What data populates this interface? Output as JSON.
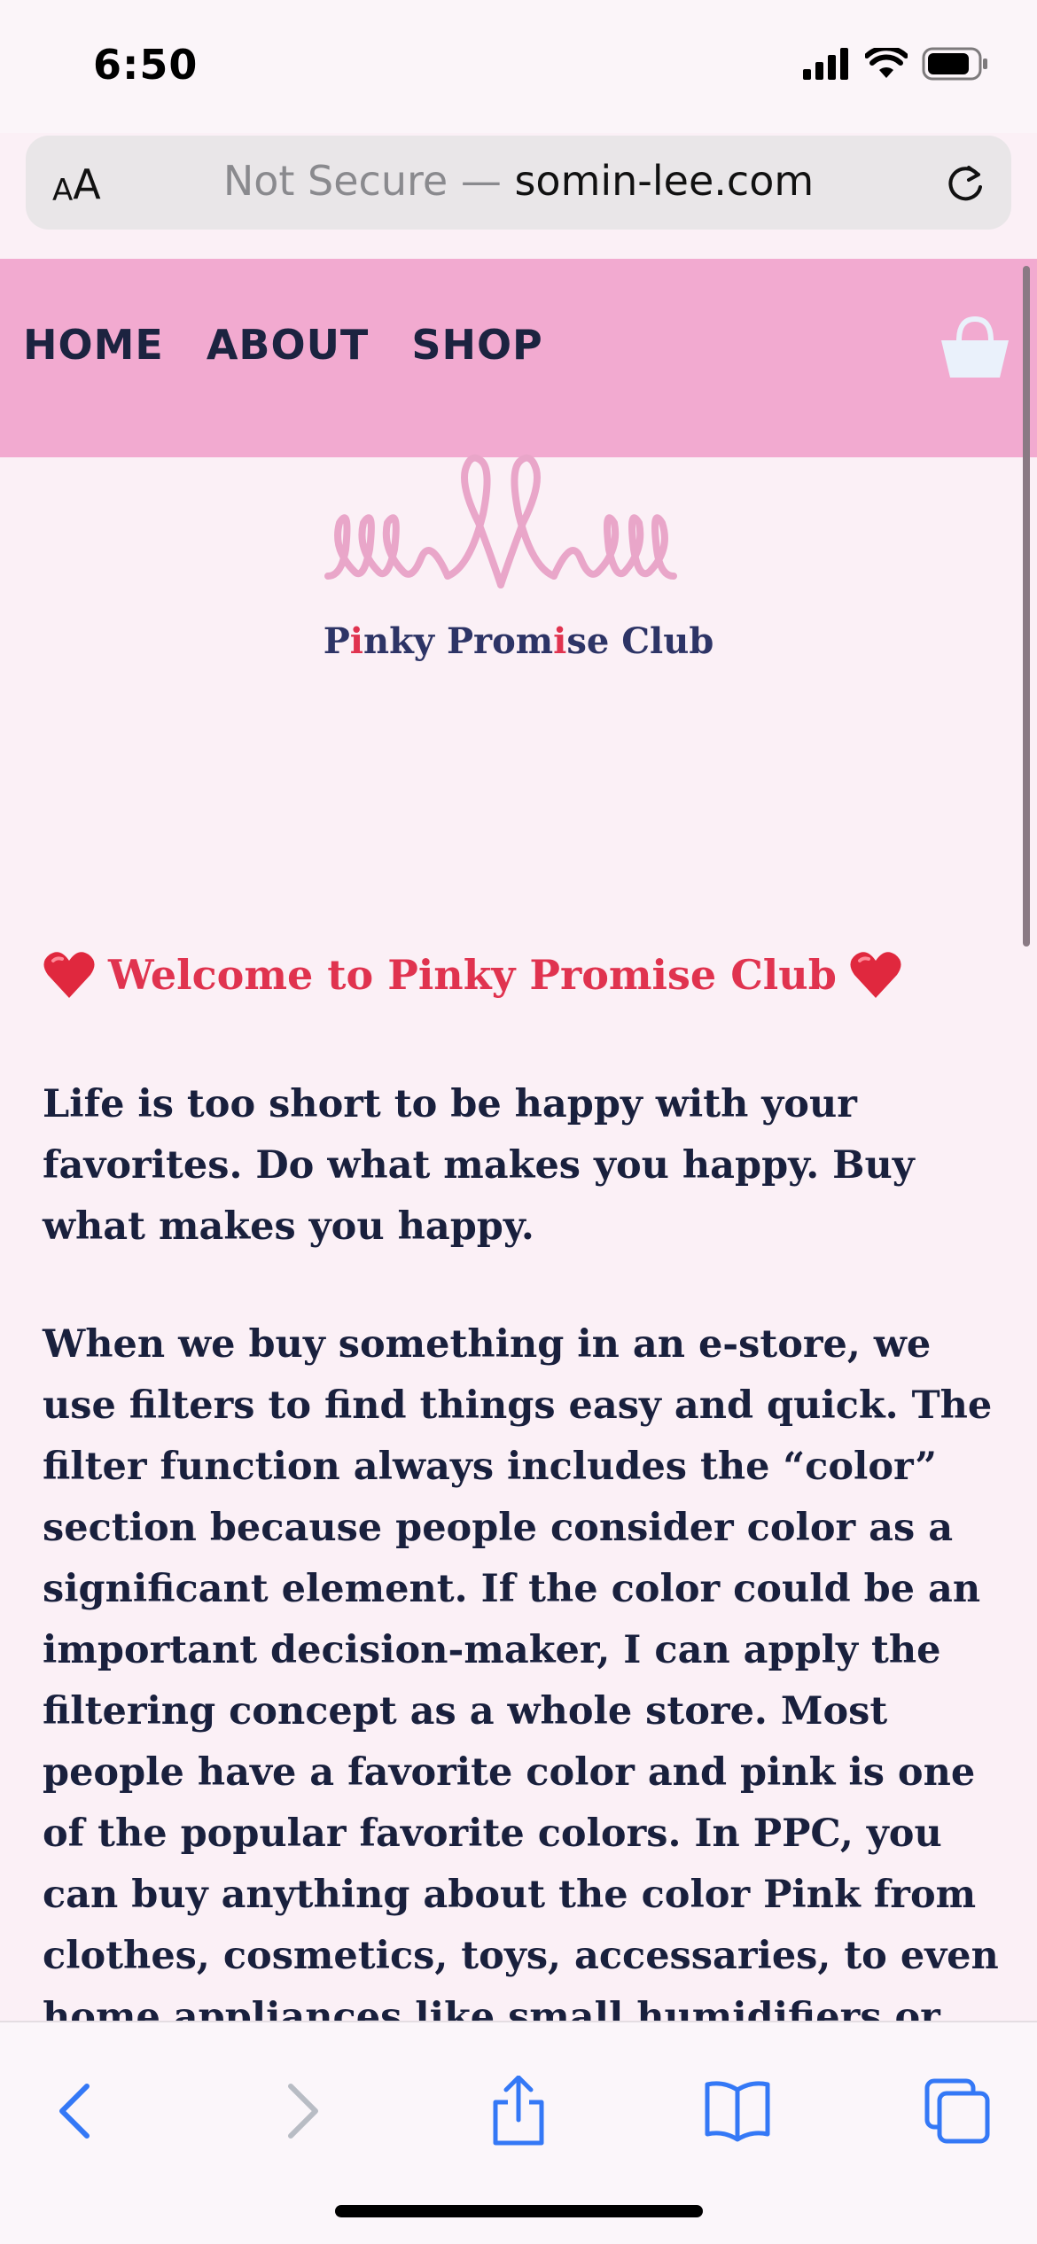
{
  "status_bar": {
    "time": "6:50",
    "icons": [
      "cellular-signal-icon",
      "wifi-icon",
      "battery-icon"
    ]
  },
  "address_bar": {
    "text_size_small": "A",
    "text_size_big": "A",
    "url_prefix": "Not Secure — ",
    "url_domain": "somin-lee.com",
    "reload_icon": "reload-icon"
  },
  "site_nav": {
    "links": [
      "HOME",
      "ABOUT",
      "SHOP"
    ],
    "cart_icon": "shopping-bag-icon",
    "background": "#f2aad0"
  },
  "logo": {
    "text_parts": [
      "P",
      "i",
      "nky Prom",
      "i",
      "se Club"
    ],
    "color": "#2d3466",
    "accent": "#e0334f"
  },
  "content": {
    "welcome": "Welcome to Pinky Promise Club",
    "paragraphs": [
      "Life is too short to be happy with your favorites. Do what makes you happy. Buy what makes you happy.",
      "When we buy something in an e-store, we use filters to find things easy and quick. The filter function always includes the “color” section because people consider color as a significant element. If the color could be an important decision-maker, I can apply the filtering concept as a whole store. Most people have a favorite color and pink is one of the popular favorite colors. In PPC, you can buy anything about the color Pink from clothes, cosmetics, toys, accessaries, to even home appliances like small humidifiers or desk stand."
    ]
  },
  "toolbar": {
    "buttons": [
      "back-icon",
      "forward-icon",
      "share-icon",
      "bookmarks-icon",
      "tabs-icon"
    ],
    "accent": "#3478f6"
  }
}
